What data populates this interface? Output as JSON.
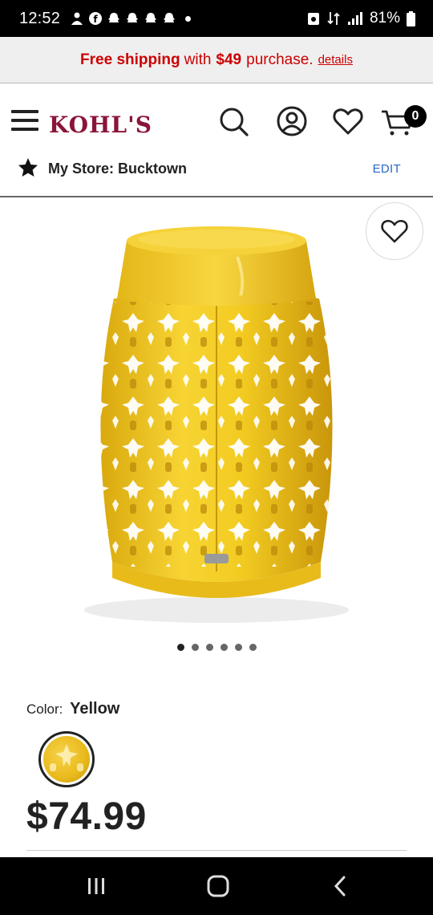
{
  "status_bar": {
    "time": "12:52",
    "battery": "81%"
  },
  "promo": {
    "free_shipping": "Free shipping",
    "with": "with",
    "amount": "$49",
    "purchase": "purchase.",
    "details": "details"
  },
  "header": {
    "logo": "KOHL'S",
    "cart_count": "0"
  },
  "store": {
    "label": "My Store: Bucktown",
    "edit": "EDIT"
  },
  "gallery": {
    "total_images": 6,
    "active_index": 0
  },
  "product": {
    "color_label": "Color:",
    "color_value": "Yellow",
    "price": "$74.99"
  },
  "colors": {
    "brand": "#8a1538",
    "promo_red": "#cc0000",
    "edit_blue": "#2a66c8",
    "product_yellow": "#f2c81e"
  }
}
